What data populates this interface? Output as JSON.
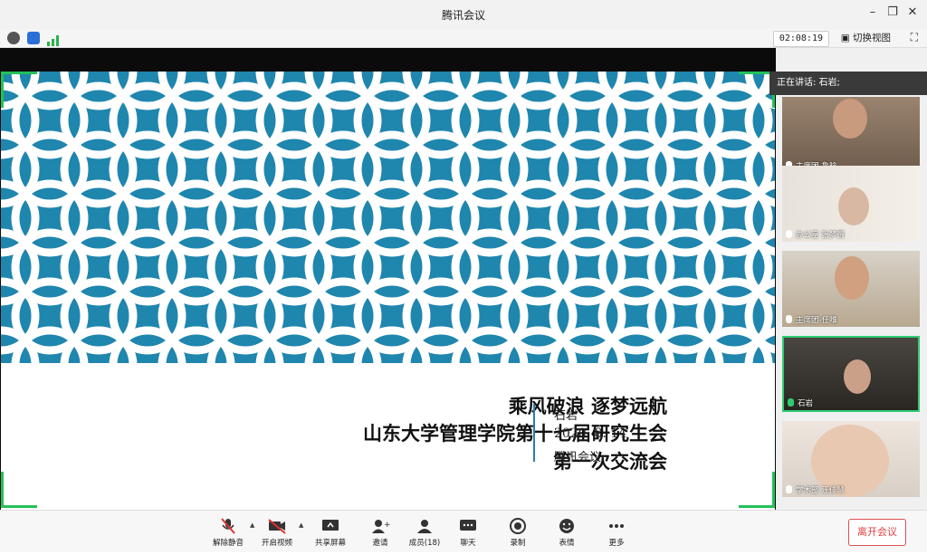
{
  "window": {
    "title": "腾讯会议"
  },
  "status": {
    "timer": "02:08:19",
    "switch_view": "切换视图"
  },
  "slide": {
    "line1": "乘风破浪  逐梦远航",
    "line2": "山东大学管理学院第十七届研究生会",
    "line3": "第一次交流会",
    "speaker": "石岩",
    "date": "2020. 8. 14",
    "platform": "腾讯会议",
    "pattern_color": "#1f86ae"
  },
  "sidebar": {
    "speaking": "正在讲话: 石岩;",
    "tiles": [
      {
        "label": "主席团-鲁晗"
      },
      {
        "label": "办公室 张梦圆"
      },
      {
        "label": "主席团-任唯"
      },
      {
        "label": "石岩"
      },
      {
        "label": "学术部 汪佳慧"
      }
    ]
  },
  "toolbar": {
    "unmute": "解除静音",
    "video": "开启视频",
    "share": "共享屏幕",
    "invite": "邀请",
    "members": "成员(18)",
    "chat": "聊天",
    "record": "录制",
    "emoji": "表情",
    "more": "更多",
    "leave": "离开会议"
  }
}
